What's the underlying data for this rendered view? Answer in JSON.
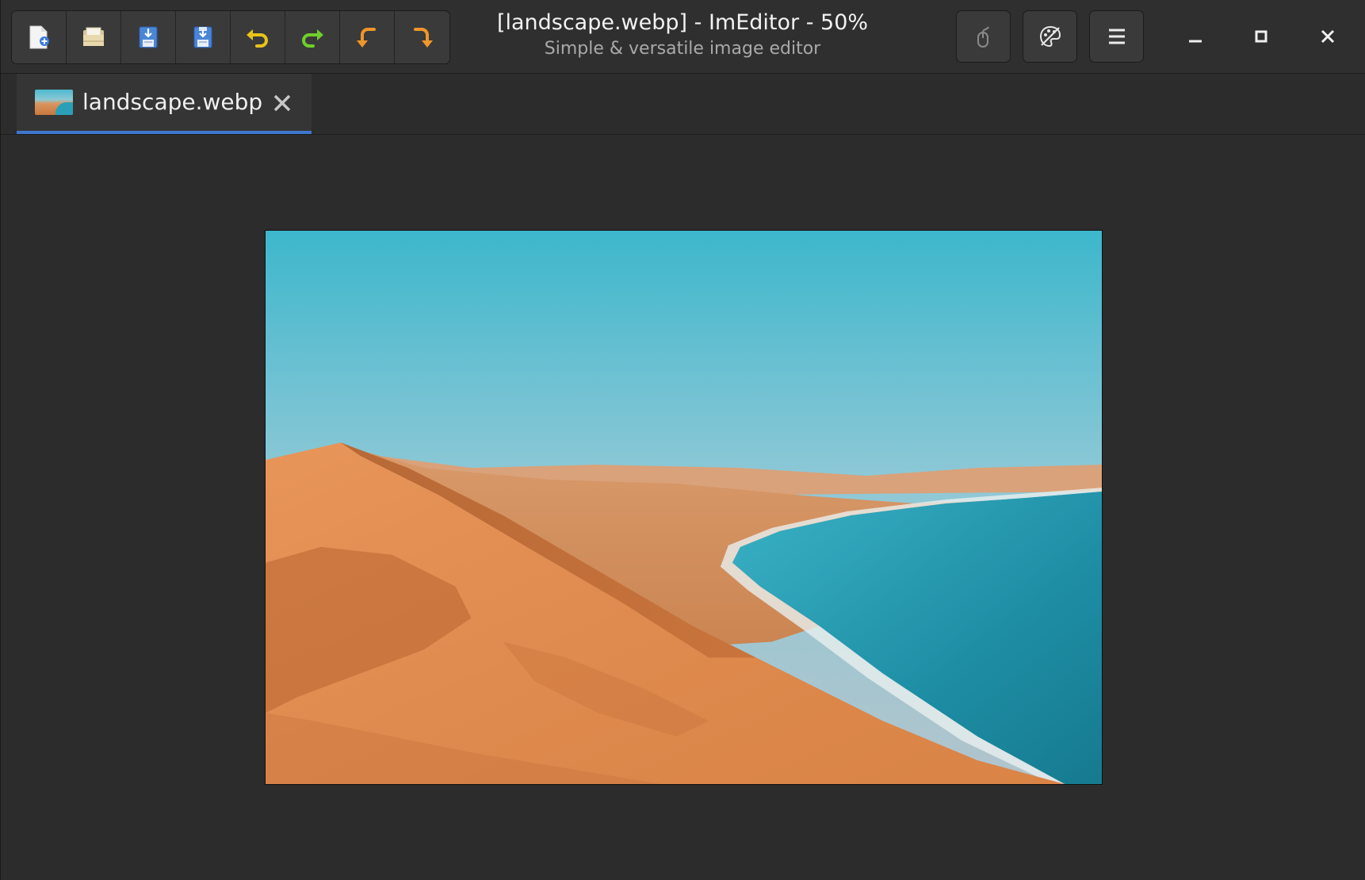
{
  "window": {
    "title": "[landscape.webp] - ImEditor - 50%",
    "subtitle": "Simple & versatile image editor"
  },
  "toolbar": {
    "buttons": [
      {
        "name": "new-file-button",
        "icon": "new-document-icon"
      },
      {
        "name": "open-file-button",
        "icon": "open-folder-icon"
      },
      {
        "name": "save-button",
        "icon": "save-icon"
      },
      {
        "name": "save-as-button",
        "icon": "save-as-icon"
      },
      {
        "name": "undo-button",
        "icon": "undo-icon"
      },
      {
        "name": "redo-button",
        "icon": "redo-icon"
      },
      {
        "name": "rotate-left-button",
        "icon": "rotate-left-icon"
      },
      {
        "name": "rotate-right-button",
        "icon": "rotate-right-icon"
      }
    ]
  },
  "header_right": {
    "buttons": [
      {
        "name": "pointer-tool-button",
        "icon": "mouse-icon"
      },
      {
        "name": "tools-button",
        "icon": "palette-icon"
      },
      {
        "name": "main-menu-button",
        "icon": "hamburger-menu-icon"
      }
    ]
  },
  "window_controls": {
    "minimize": "minimize-icon",
    "maximize": "maximize-icon",
    "close": "close-icon"
  },
  "tabs": [
    {
      "label": "landscape.webp",
      "active": true
    }
  ],
  "canvas": {
    "image_name": "landscape.webp",
    "zoom": "50%"
  },
  "colors": {
    "accent": "#3e78d0",
    "background": "#2c2c2c",
    "headerbar": "#2f2f2f"
  }
}
